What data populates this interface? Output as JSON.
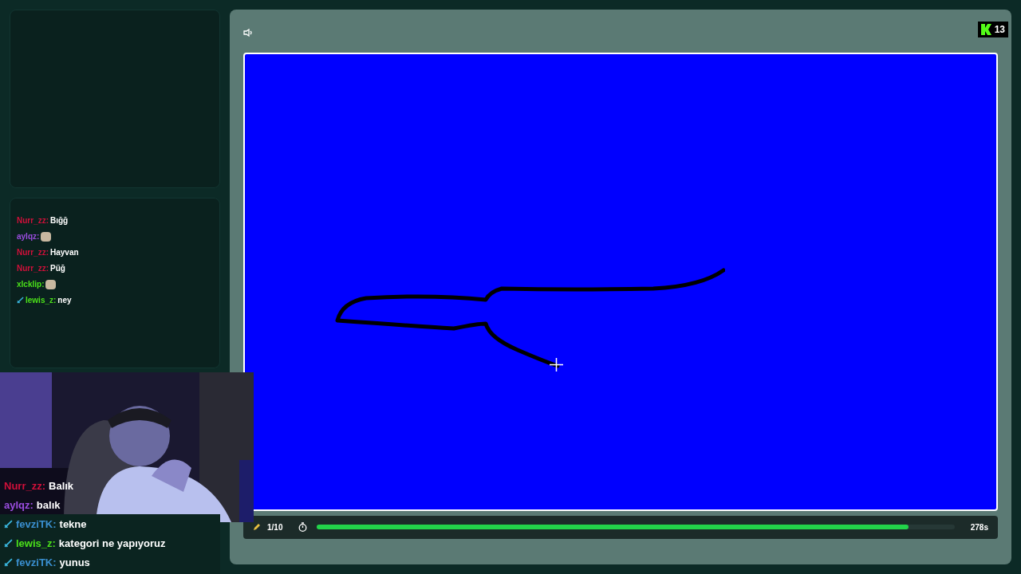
{
  "small_chat": [
    {
      "user": "Nurr_zz:",
      "color": "#d0103a",
      "kind": "text",
      "text": "Bığğ",
      "badge": false
    },
    {
      "user": "aylqz:",
      "color": "#9b4de0",
      "kind": "emote",
      "badge": false
    },
    {
      "user": "Nurr_zz:",
      "color": "#d0103a",
      "kind": "text",
      "text": "Hayvan",
      "badge": false
    },
    {
      "user": "Nurr_zz:",
      "color": "#d0103a",
      "kind": "text",
      "text": "Püğ",
      "badge": false
    },
    {
      "user": "xlcklip:",
      "color": "#4be01a",
      "kind": "emote",
      "badge": false
    },
    {
      "user": "lewis_z:",
      "color": "#4be01a",
      "kind": "text",
      "text": "ney",
      "badge": true
    }
  ],
  "overlay_chat": [
    {
      "user": "Nurr_zz:",
      "color": "#d0103a",
      "text": "Balık",
      "badge": false
    },
    {
      "user": "aylqz:",
      "color": "#9b4de0",
      "text": "balık",
      "badge": false
    },
    {
      "user": "fevziTK:",
      "color": "#3a8fd0",
      "text": "tekne",
      "badge": true
    },
    {
      "user": "lewis_z:",
      "color": "#4be01a",
      "text": "kategori ne yapıyoruz",
      "badge": true
    },
    {
      "user": "fevziTK:",
      "color": "#3a8fd0",
      "text": "yunus",
      "badge": true
    }
  ],
  "viewer_badge": {
    "count": "13"
  },
  "game": {
    "round": "1/10",
    "timer": {
      "level": 0.928,
      "reading": "278s"
    }
  }
}
